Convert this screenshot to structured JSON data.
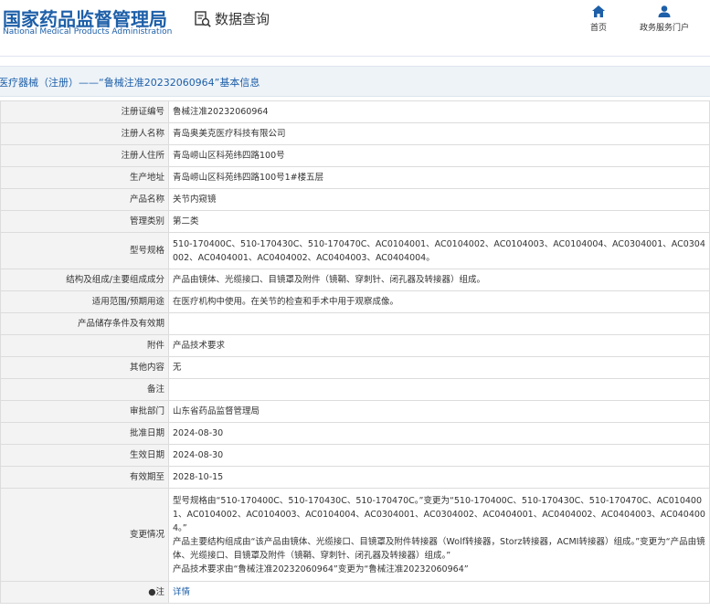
{
  "header": {
    "logo_cn": "国家药品监督管理局",
    "logo_en": "National Medical Products Administration",
    "query_label": "数据查询",
    "nav_home": "首页",
    "nav_service": "政务服务门户"
  },
  "title": "医疗器械（注册）——“鲁械注准20232060964”基本信息",
  "rows": [
    {
      "label": "注册证编号",
      "value": "鲁械注准20232060964"
    },
    {
      "label": "注册人名称",
      "value": "青岛奥美克医疗科技有限公司"
    },
    {
      "label": "注册人住所",
      "value": "青岛崂山区科苑纬四路100号"
    },
    {
      "label": "生产地址",
      "value": "青岛崂山区科苑纬四路100号1#楼五层"
    },
    {
      "label": "产品名称",
      "value": "关节内窥镜"
    },
    {
      "label": "管理类别",
      "value": "第二类"
    },
    {
      "label": "型号规格",
      "value": "510-170400C、510-170430C、510-170470C、AC0104001、AC0104002、AC0104003、AC0104004、AC0304001、AC0304002、AC0404001、AC0404002、AC0404003、AC0404004。"
    },
    {
      "label": "结构及组成/主要组成成分",
      "value": "产品由镜体、光缆接口、目镜罩及附件（镜鞘、穿刺针、闭孔器及转接器）组成。"
    },
    {
      "label": "适用范围/预期用途",
      "value": "在医疗机构中使用。在关节的检查和手术中用于观察成像。"
    },
    {
      "label": "产品储存条件及有效期",
      "value": ""
    },
    {
      "label": "附件",
      "value": "产品技术要求"
    },
    {
      "label": "其他内容",
      "value": "无"
    },
    {
      "label": "备注",
      "value": ""
    },
    {
      "label": "审批部门",
      "value": "山东省药品监督管理局"
    },
    {
      "label": "批准日期",
      "value": "2024-08-30"
    },
    {
      "label": "生效日期",
      "value": "2024-08-30"
    },
    {
      "label": "有效期至",
      "value": "2028-10-15"
    }
  ],
  "change": {
    "label": "变更情况",
    "line1": "型号规格由“510-170400C、510-170430C、510-170470C。”变更为“510-170400C、510-170430C、510-170470C、AC0104001、AC0104002、AC0104003、AC0104004、AC0304001、AC0304002、AC0404001、AC0404002、AC0404003、AC0404004。”",
    "line2": "产品主要结构组成由“该产品由镜体、光缆接口、目镜罩及附件转接器（Wolf转接器，Storz转接器，ACMI转接器）组成。”变更为“产品由镜体、光缆接口、目镜罩及附件（镜鞘、穿刺针、闭孔器及转接器）组成。”",
    "line3": "产品技术要求由“鲁械注准20232060964”变更为“鲁械注准20232060964”"
  },
  "note": {
    "label": "注",
    "link": "详情"
  }
}
